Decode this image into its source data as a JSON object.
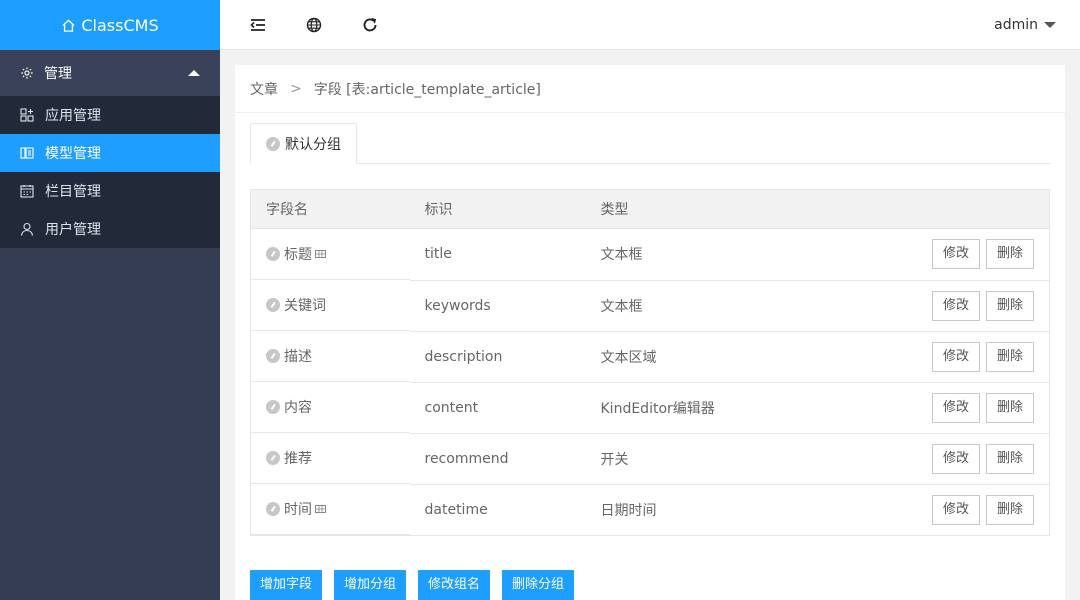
{
  "app": {
    "title": "ClassCMS"
  },
  "sidebar": {
    "section_label": "管理",
    "items": [
      {
        "label": "应用管理",
        "icon": "apps-icon"
      },
      {
        "label": "模型管理",
        "icon": "model-icon",
        "active": true
      },
      {
        "label": "栏目管理",
        "icon": "calendar-icon"
      },
      {
        "label": "用户管理",
        "icon": "user-icon"
      }
    ]
  },
  "topbar": {
    "icons": [
      "collapse-menu-icon",
      "globe-icon",
      "refresh-icon"
    ],
    "user": "admin"
  },
  "breadcrumb": {
    "parent": "文章",
    "separator": ">",
    "current": "字段 [表:article_template_article]"
  },
  "tabs": [
    {
      "label": "默认分组"
    }
  ],
  "table": {
    "headers": [
      "字段名",
      "标识",
      "类型"
    ],
    "rows": [
      {
        "name": "标题",
        "key": "title",
        "type": "文本框",
        "grid_icon": true
      },
      {
        "name": "关键词",
        "key": "keywords",
        "type": "文本框",
        "grid_icon": false
      },
      {
        "name": "描述",
        "key": "description",
        "type": "文本区域",
        "grid_icon": false
      },
      {
        "name": "内容",
        "key": "content",
        "type": "KindEditor编辑器",
        "grid_icon": false
      },
      {
        "name": "推荐",
        "key": "recommend",
        "type": "开关",
        "grid_icon": false
      },
      {
        "name": "时间",
        "key": "datetime",
        "type": "日期时间",
        "grid_icon": true
      }
    ],
    "edit_label": "修改",
    "delete_label": "删除"
  },
  "actions": [
    "增加字段",
    "增加分组",
    "修改组名",
    "删除分组"
  ],
  "colors": {
    "accent": "#1e9fff",
    "sidebar": "#343d52",
    "sidebar_sub": "#222a3a"
  }
}
